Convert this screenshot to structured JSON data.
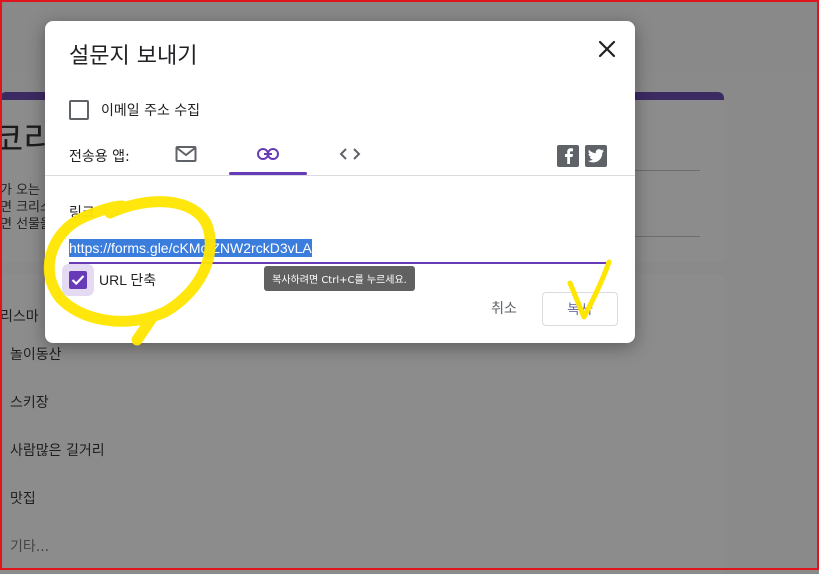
{
  "background": {
    "form_title": "코리",
    "form_desc_lines": [
      "가 오는",
      "면 크리스",
      "면 선물을"
    ],
    "question": "리스마",
    "options": [
      "놀이동산",
      "스키장",
      "사람많은 길거리",
      "맛집",
      "기타..."
    ]
  },
  "dialog": {
    "title": "설문지 보내기",
    "collect_email_label": "이메일 주소 수집",
    "send_via_label": "전송용 앱:",
    "tabs": [
      "email-icon",
      "link-icon",
      "embed-icon"
    ],
    "active_tab": "link",
    "link_section_label": "링크",
    "link_url": "https://forms.gle/cKMoiZNW2rckD3vLA",
    "shorten_label": "URL 단축",
    "shorten_checked": true,
    "tooltip": "복사하려면 Ctrl+C를 누르세요.",
    "cancel_label": "취소",
    "copy_label": "복사"
  },
  "colors": {
    "accent": "#673ab7",
    "selection": "#3b7ddd",
    "annotation": "#ffe600",
    "frame": "#e0141c"
  }
}
